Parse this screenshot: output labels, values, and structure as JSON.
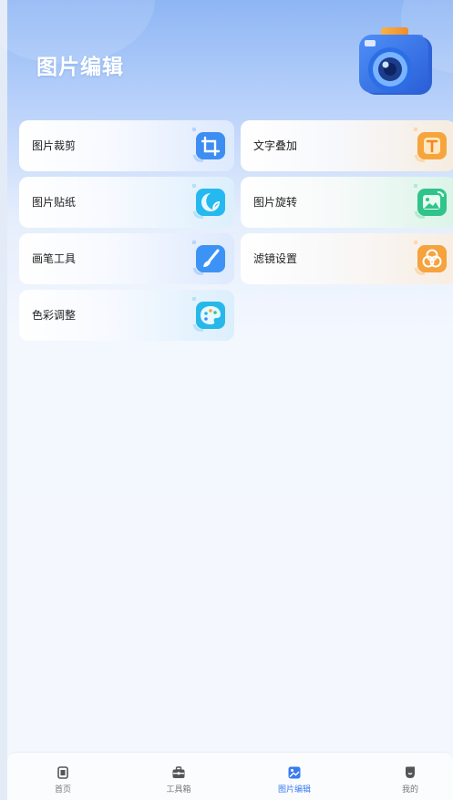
{
  "header": {
    "title": "图片编辑"
  },
  "features": [
    {
      "label": "图片裁剪",
      "icon": "crop-icon",
      "color": "#3d8ef2"
    },
    {
      "label": "文字叠加",
      "icon": "text-icon",
      "color": "#f6a53c"
    },
    {
      "label": "图片贴纸",
      "icon": "sticker-icon",
      "color": "#25b9f0"
    },
    {
      "label": "图片旋转",
      "icon": "image-rotate-icon",
      "color": "#2fc48a"
    },
    {
      "label": "画笔工具",
      "icon": "brush-icon",
      "color": "#3d93f5"
    },
    {
      "label": "滤镜设置",
      "icon": "filter-icon",
      "color": "#f6a23d"
    },
    {
      "label": "色彩调整",
      "icon": "palette-icon",
      "color": "#27b8ea"
    }
  ],
  "tabbar": {
    "tabs": [
      {
        "label": "首页",
        "icon": "home-icon"
      },
      {
        "label": "工具箱",
        "icon": "toolbox-icon"
      },
      {
        "label": "图片编辑",
        "icon": "image-edit-icon"
      },
      {
        "label": "我的",
        "icon": "profile-icon"
      }
    ],
    "active_index": 2,
    "active_color": "#3a7bf0"
  }
}
